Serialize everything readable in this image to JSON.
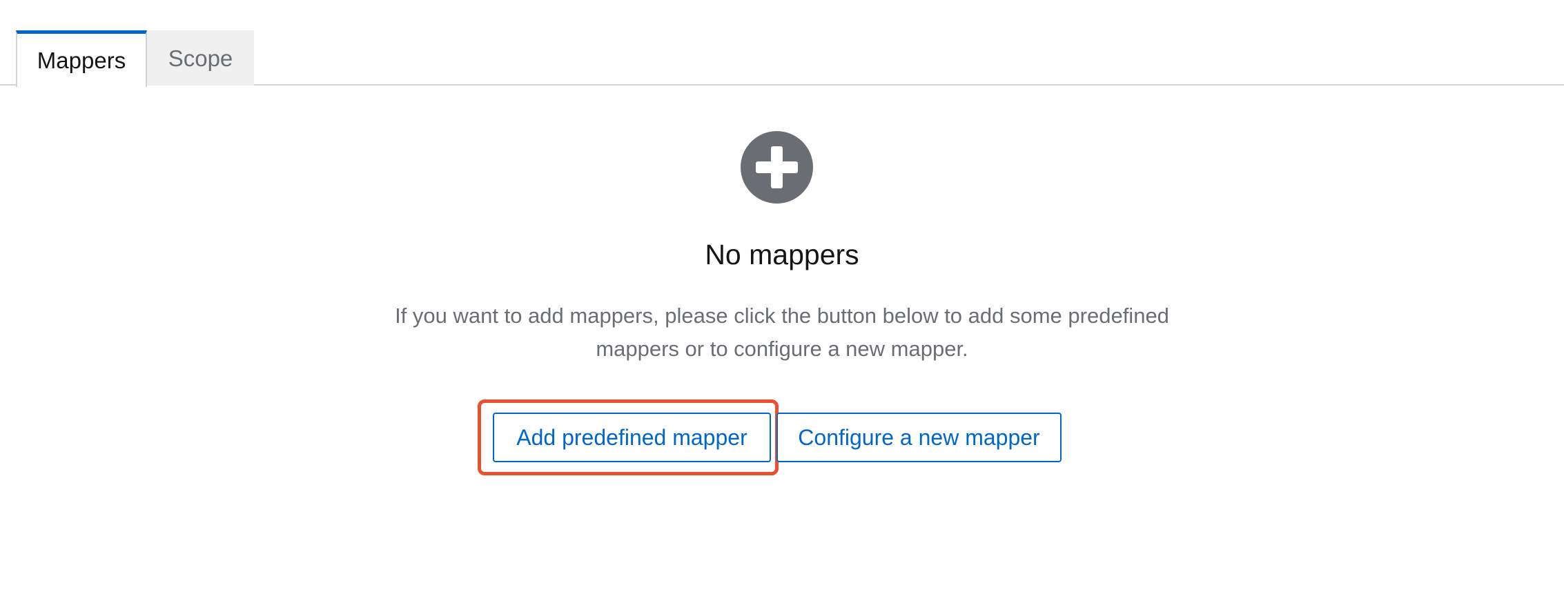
{
  "tabs": [
    {
      "label": "Mappers",
      "active": true
    },
    {
      "label": "Scope",
      "active": false
    }
  ],
  "empty_state": {
    "icon": "plus-circle-icon",
    "title": "No mappers",
    "body_line1": "If you want to add mappers, please click the button below to add some predefined",
    "body_line2": "mappers or to configure a new mapper.",
    "primary_action": "Add predefined mapper",
    "secondary_action": "Configure a new mapper"
  },
  "colors": {
    "accent": "#0066cc",
    "icon_gray": "#6a6e73",
    "highlight": "#e8502e"
  }
}
